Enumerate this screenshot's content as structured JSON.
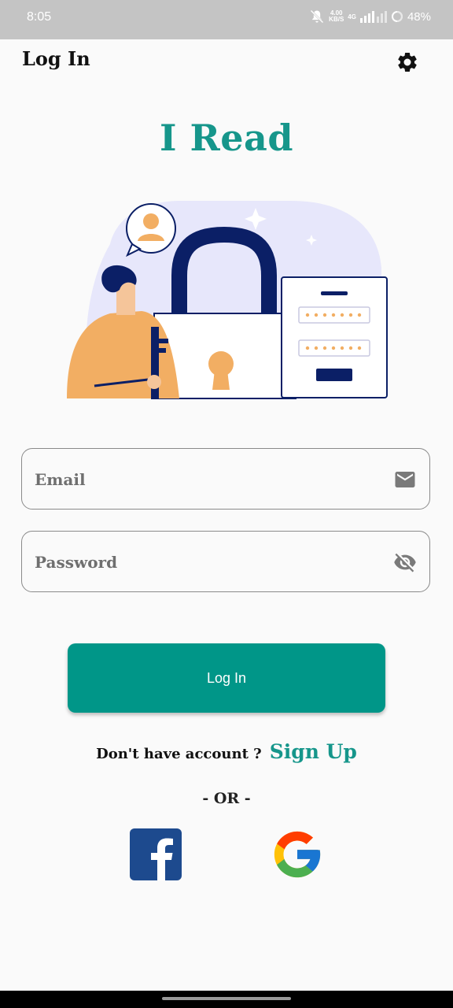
{
  "status_bar": {
    "time": "8:05",
    "net_speed_value": "4.00",
    "net_speed_unit": "KB/S",
    "network": "4G",
    "battery": "48%",
    "icons": [
      "mute-icon",
      "signal-icon",
      "battery-icon"
    ]
  },
  "app_bar": {
    "title": "Log In",
    "settings_icon": "gear-icon"
  },
  "brand": {
    "title": "I Read"
  },
  "hero": {
    "description_icon": "login-security-illustration"
  },
  "form": {
    "email": {
      "placeholder": "Email",
      "value": "",
      "icon": "mail-icon"
    },
    "password": {
      "placeholder": "Password",
      "value": "",
      "icon": "eye-off-icon"
    },
    "login_label": "Log In"
  },
  "signup": {
    "prompt": "Don't have account ?",
    "link": "Sign Up"
  },
  "divider": {
    "text": "- OR -"
  },
  "social": {
    "facebook_icon": "facebook-icon",
    "google_icon": "google-icon"
  },
  "colors": {
    "accent": "#009688",
    "brand_text": "#16968b",
    "illustration_navy": "#0b1f66",
    "illustration_orange": "#f2ae63",
    "illustration_lavender": "#e7e7fb",
    "facebook_blue": "#1d4a8e"
  }
}
